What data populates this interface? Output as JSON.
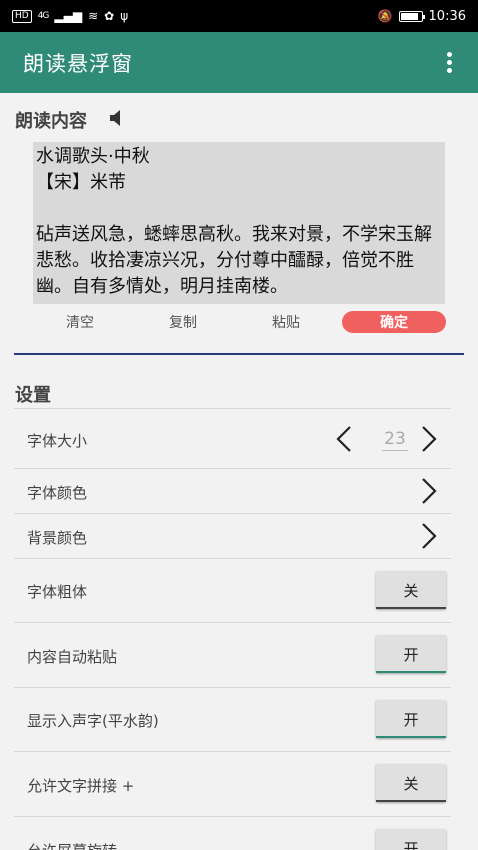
{
  "status_bar": {
    "badge": "HD",
    "signal": "4G",
    "time": "10:36",
    "battery_level": 0.85
  },
  "app_bar": {
    "title": "朗读悬浮窗",
    "menu_icon": "overflow-menu-icon"
  },
  "read_section": {
    "title": "朗读内容",
    "speaker_icon": "speaker-icon",
    "text": "水调歌头·中秋\n【宋】米芾\n\n砧声送风急，蟋蟀思高秋。我来对景，不学宋玉解悲愁。收拾凄凉兴况，分付尊中醽醁，倍觉不胜幽。自有多情处，明月挂南楼。"
  },
  "actions": {
    "clear": "清空",
    "copy": "复制",
    "paste": "粘贴",
    "confirm": "确定"
  },
  "settings": {
    "title": "设置",
    "font_size_label": "字体大小",
    "font_size_value": "23",
    "font_color_label": "字体颜色",
    "bg_color_label": "背景颜色",
    "bold_label": "字体粗体",
    "bold_state": "关",
    "auto_paste_label": "内容自动粘贴",
    "auto_paste_state": "开",
    "show_rusheng_label": "显示入声字(平水韵)",
    "show_rusheng_state": "开",
    "allow_concat_label": "允许文字拼接 +",
    "allow_concat_state": "关",
    "allow_rotate_label": "允许屏幕旋转",
    "allow_rotate_state": "开"
  },
  "colors": {
    "primary": "#2f8b77",
    "accent": "#f0605f",
    "divider": "#2a3a7a"
  }
}
